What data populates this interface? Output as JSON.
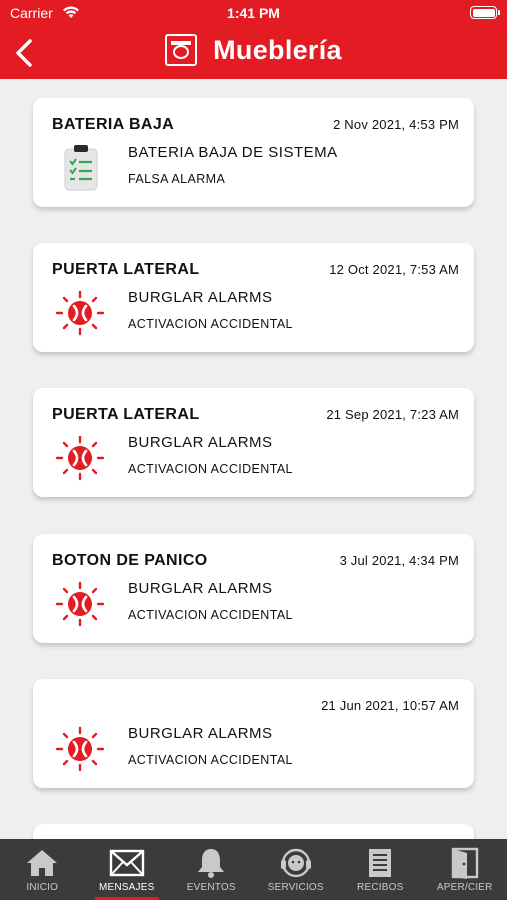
{
  "status_bar": {
    "carrier": "Carrier",
    "time": "1:41 PM"
  },
  "header": {
    "title": "Mueblería",
    "accent_color": "#e31b23"
  },
  "messages": [
    {
      "title": "BATERIA BAJA",
      "date": "2 Nov 2021, 4:53 PM",
      "type": "BATERIA BAJA DE SISTEMA",
      "detail": "FALSA ALARMA",
      "icon": "clipboard-check-icon"
    },
    {
      "title": "PUERTA LATERAL",
      "date": "12 Oct 2021, 7:53 AM",
      "type": "BURGLAR ALARMS",
      "detail": "ACTIVACION ACCIDENTAL",
      "icon": "burglar-alarm-icon"
    },
    {
      "title": "PUERTA LATERAL",
      "date": "21 Sep 2021, 7:23 AM",
      "type": "BURGLAR ALARMS",
      "detail": "ACTIVACION ACCIDENTAL",
      "icon": "burglar-alarm-icon"
    },
    {
      "title": "BOTON DE PANICO",
      "date": "3 Jul 2021, 4:34 PM",
      "type": "BURGLAR ALARMS",
      "detail": "ACTIVACION ACCIDENTAL",
      "icon": "burglar-alarm-icon"
    },
    {
      "title": "",
      "date": "21 Jun 2021, 10:57 AM",
      "type": "BURGLAR ALARMS",
      "detail": "ACTIVACION ACCIDENTAL",
      "icon": "burglar-alarm-icon"
    },
    {
      "title": "",
      "date": "",
      "type": "",
      "detail": "",
      "icon": ""
    }
  ],
  "tabs": [
    {
      "label": "INICIO",
      "icon": "home-icon",
      "active": false
    },
    {
      "label": "MENSAJES",
      "icon": "envelope-icon",
      "active": true
    },
    {
      "label": "EVENTOS",
      "icon": "bell-icon",
      "active": false
    },
    {
      "label": "SERVICIOS",
      "icon": "headset-icon",
      "active": false
    },
    {
      "label": "RECIBOS",
      "icon": "receipt-icon",
      "active": false
    },
    {
      "label": "APER/CIER",
      "icon": "door-icon",
      "active": false
    }
  ]
}
